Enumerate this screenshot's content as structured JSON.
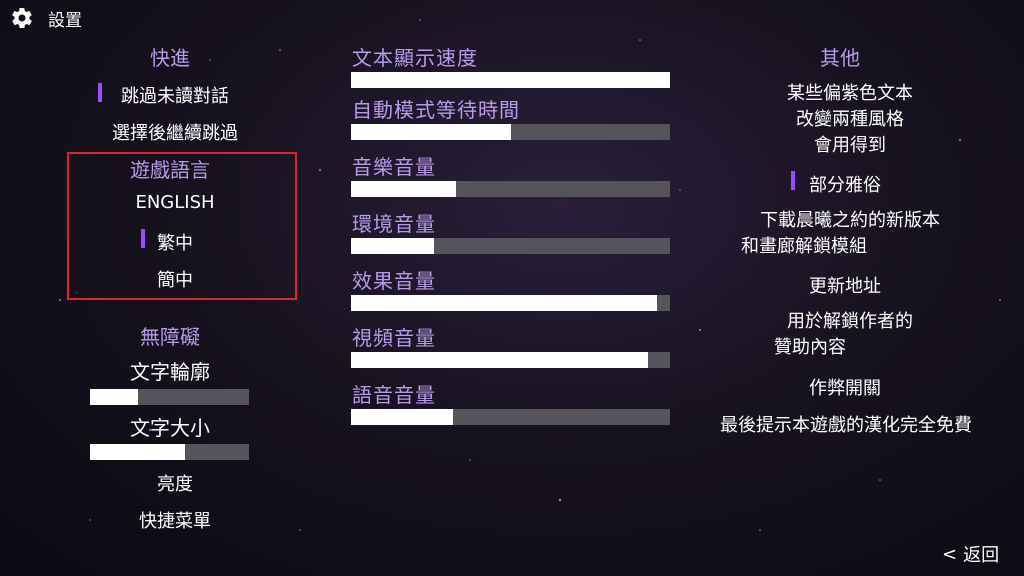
{
  "header": {
    "title": "設置",
    "icon": "gear-icon"
  },
  "left": {
    "skip_header": "快進",
    "skip_unread": "跳過未讀對話",
    "skip_after_choice": "選擇後繼續跳過",
    "lang_header": "遊戲語言",
    "lang_options": [
      "ENGLISH",
      "繁中",
      "簡中"
    ],
    "lang_selected": "繁中",
    "access_header": "無障礙",
    "text_outline": "文字輪廓",
    "text_outline_value": 0.3,
    "text_size": "文字大小",
    "text_size_value": 0.6,
    "brightness": "亮度",
    "shortcut_menu": "快捷菜單"
  },
  "middle": {
    "sliders": [
      {
        "label": "文本顯示速度",
        "value": 1.0
      },
      {
        "label": "自動模式等待時間",
        "value": 0.5
      },
      {
        "label": "音樂音量",
        "value": 0.33
      },
      {
        "label": "環境音量",
        "value": 0.26
      },
      {
        "label": "效果音量",
        "value": 0.96
      },
      {
        "label": "視頻音量",
        "value": 0.93
      },
      {
        "label": "語音音量",
        "value": 0.32
      }
    ]
  },
  "right": {
    "header": "其他",
    "purple_text_note": [
      "某些偏紫色文本",
      "改變兩種風格",
      "會用得到"
    ],
    "partial_vulgar": "部分雅俗",
    "download_note": [
      "下載晨曦之約的新版本",
      "和畫廊解鎖模組"
    ],
    "update_address": "更新地址",
    "unlock_note": [
      "用於解鎖作者的",
      "贊助內容"
    ],
    "cheat_switch": "作弊開關",
    "free_note": "最後提示本遊戲的漢化完全免費"
  },
  "footer": {
    "back": "返回"
  },
  "colors": {
    "accent": "#9b4dff",
    "header": "#b89be6",
    "track": "#56545b",
    "highlight_box": "#e0242f"
  }
}
